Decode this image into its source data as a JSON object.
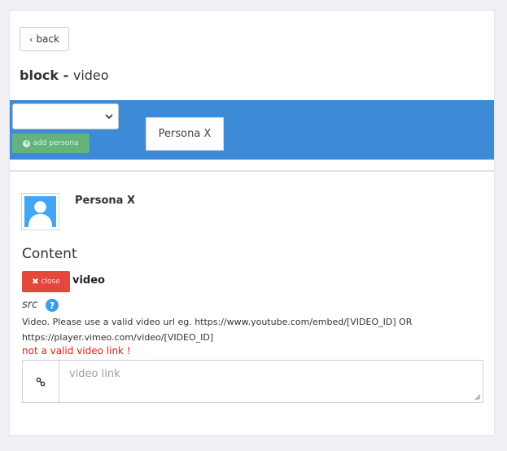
{
  "nav": {
    "back_label": "back"
  },
  "title": {
    "strong": "block - ",
    "rest": "video"
  },
  "persona_bar": {
    "select_value": "",
    "add_label": "add persona",
    "tabs": [
      {
        "label": "Persona X"
      }
    ]
  },
  "persona": {
    "name": "Persona X"
  },
  "content": {
    "heading": "Content",
    "close_label": "close",
    "block_type": "video",
    "field_label": "src",
    "help_text": "Video. Please use a valid video url eg. https://www.youtube.com/embed/[VIDEO_ID] OR https://player.vimeo.com/video/[VIDEO_ID]",
    "error_text": "not a valid video link !",
    "input_value": "",
    "input_placeholder": "video link"
  },
  "colors": {
    "band": "#3d8bd6",
    "add_button": "#64b27d",
    "close_button": "#e4473b",
    "error": "#e01b1b",
    "help_icon": "#3a9ee4"
  },
  "icons": {
    "back": "chevron-left-icon",
    "add": "plus-circle-icon",
    "close": "x-icon",
    "help": "question-circle-icon",
    "link": "link-icon",
    "avatar": "user-silhouette-icon"
  }
}
